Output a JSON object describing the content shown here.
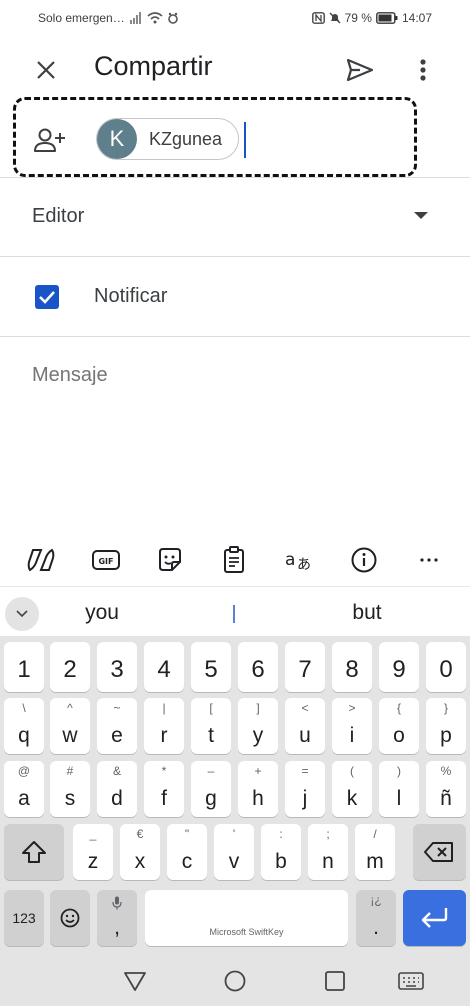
{
  "status_bar": {
    "carrier": "Solo emergen…",
    "battery": "79 %",
    "time": "14:07"
  },
  "app_bar": {
    "title": "Compartir"
  },
  "recipient": {
    "avatar_letter": "K",
    "name": "KZgunea"
  },
  "role": {
    "selected": "Editor"
  },
  "notify": {
    "label": "Notificar",
    "checked": true
  },
  "message": {
    "placeholder": "Mensaje"
  },
  "keyboard": {
    "suggestions": [
      "you",
      "but"
    ],
    "number_row": [
      "1",
      "2",
      "3",
      "4",
      "5",
      "6",
      "7",
      "8",
      "9",
      "0"
    ],
    "row1": [
      {
        "main": "q",
        "alt": "\\"
      },
      {
        "main": "w",
        "alt": "^"
      },
      {
        "main": "e",
        "alt": "~"
      },
      {
        "main": "r",
        "alt": "|"
      },
      {
        "main": "t",
        "alt": "["
      },
      {
        "main": "y",
        "alt": "]"
      },
      {
        "main": "u",
        "alt": "<"
      },
      {
        "main": "i",
        "alt": ">"
      },
      {
        "main": "o",
        "alt": "{"
      },
      {
        "main": "p",
        "alt": "}"
      }
    ],
    "row2": [
      {
        "main": "a",
        "alt": "@"
      },
      {
        "main": "s",
        "alt": "#"
      },
      {
        "main": "d",
        "alt": "&"
      },
      {
        "main": "f",
        "alt": "*"
      },
      {
        "main": "g",
        "alt": "–"
      },
      {
        "main": "h",
        "alt": "+"
      },
      {
        "main": "j",
        "alt": "="
      },
      {
        "main": "k",
        "alt": "("
      },
      {
        "main": "l",
        "alt": ")"
      },
      {
        "main": "ñ",
        "alt": "%"
      }
    ],
    "row3": [
      {
        "main": "z",
        "alt": "_"
      },
      {
        "main": "x",
        "alt": "€"
      },
      {
        "main": "c",
        "alt": "\""
      },
      {
        "main": "v",
        "alt": "'"
      },
      {
        "main": "b",
        "alt": ":"
      },
      {
        "main": "n",
        "alt": ";"
      },
      {
        "main": "m",
        "alt": "/"
      }
    ],
    "symbols_key": "123",
    "comma_key": ",",
    "period_key": ".",
    "period_alt": "¡¿",
    "space_label": "Microsoft SwiftKey"
  },
  "colors": {
    "accent": "#1a55c7",
    "enter_key": "#3a6fe0",
    "avatar": "#5f7f8c"
  }
}
